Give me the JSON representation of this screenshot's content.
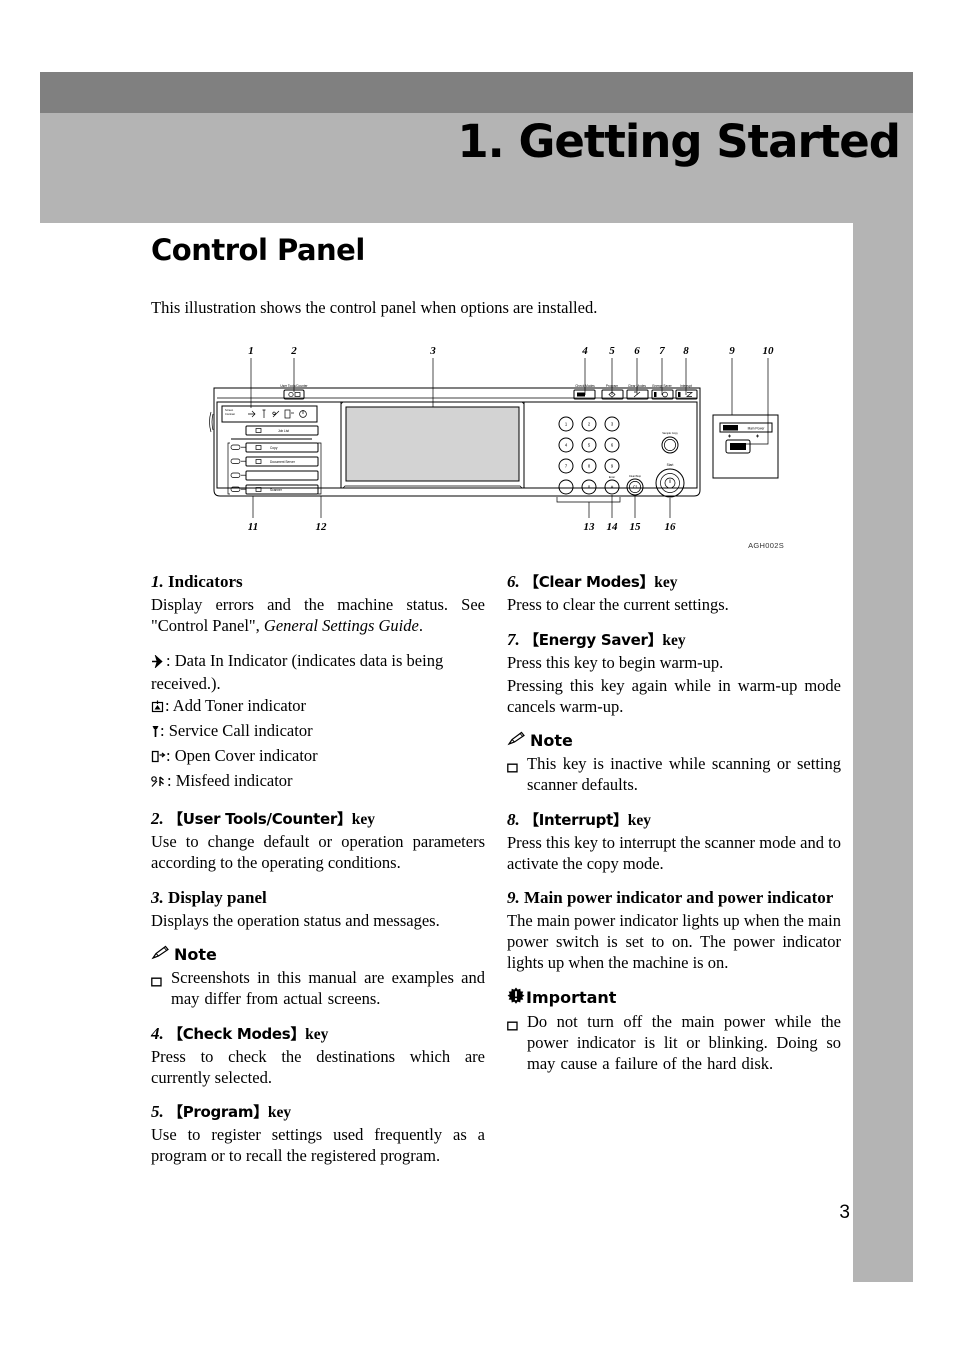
{
  "chapter": {
    "title": "1. Getting Started"
  },
  "section": {
    "title": "Control Panel",
    "intro": "This illustration shows the control panel when options are installed."
  },
  "figure": {
    "id_label": "AGH002S",
    "callout_numbers_top": [
      "1",
      "2",
      "3",
      "4",
      "5",
      "6",
      "7",
      "8",
      "9",
      "10"
    ],
    "callout_numbers_bottom": [
      "11",
      "12",
      "13",
      "14",
      "15",
      "16"
    ],
    "panel_labels": {
      "user_tools_counter": "User Tools/Counter",
      "check_modes": "Check Modes",
      "program": "Program",
      "clear_modes": "Clear Modes",
      "energy_saver": "Energy Saver",
      "interrupt": "Interrupt",
      "main_power": "Main Power",
      "on": "On",
      "sample_copy": "Sample Copy",
      "start": "Start",
      "clear_stop": "Clear/Stop",
      "job_list": "Job List",
      "copy": "Copy",
      "document_server": "Document Server",
      "scanner": "Scanner",
      "screen_contrast": "Screen Contrast"
    },
    "keypad_keys": [
      "1",
      "2",
      "3",
      "4",
      "5",
      "6",
      "7",
      "8",
      "9",
      ".",
      "0",
      "#"
    ]
  },
  "items": {
    "left": [
      {
        "num": "1.",
        "heading": "Indicators",
        "heading_kind": "plain",
        "paragraphs": [
          {
            "kind": "rich",
            "parts": [
              {
                "text": "Display errors and the machine status. See \"Control Panel\", ",
                "italic": false
              },
              {
                "text": "General Settings Guide",
                "italic": true
              },
              {
                "text": ".",
                "italic": false
              }
            ]
          }
        ],
        "indicators": [
          {
            "icon": "data-in-icon",
            "text": ": Data In Indicator (indicates data is being received.)."
          },
          {
            "icon": "add-toner-icon",
            "text": ": Add Toner indicator"
          },
          {
            "icon": "service-call-icon",
            "text": ": Service Call indicator"
          },
          {
            "icon": "open-cover-icon",
            "text": ": Open Cover indicator"
          },
          {
            "icon": "misfeed-icon",
            "text": ": Misfeed indicator"
          }
        ]
      },
      {
        "num": "2.",
        "heading_key": "User Tools/Counter",
        "heading_suffix": "key",
        "heading_kind": "key",
        "paragraphs": [
          {
            "kind": "plain",
            "text": "Use to change default or operation parameters according to the operating conditions."
          }
        ]
      },
      {
        "num": "3.",
        "heading": "Display panel",
        "heading_kind": "plain",
        "paragraphs": [
          {
            "kind": "plain",
            "text": "Displays the operation status and messages."
          }
        ],
        "note": {
          "label": "Note",
          "bullets": [
            "Screenshots in this manual are examples and may differ from actual screens."
          ]
        }
      },
      {
        "num": "4.",
        "heading_key": "Check Modes",
        "heading_suffix": "key",
        "heading_kind": "key",
        "paragraphs": [
          {
            "kind": "plain",
            "text": "Press to check the destinations which are currently selected."
          }
        ]
      },
      {
        "num": "5.",
        "heading_key": "Program",
        "heading_suffix": "key",
        "heading_kind": "key",
        "paragraphs": [
          {
            "kind": "plain",
            "text": "Use to register settings used frequently as a program or to recall the registered program."
          }
        ]
      }
    ],
    "right": [
      {
        "num": "6.",
        "heading_key": "Clear Modes",
        "heading_suffix": "key",
        "heading_kind": "key",
        "paragraphs": [
          {
            "kind": "plain",
            "text": "Press to clear the current settings."
          }
        ]
      },
      {
        "num": "7.",
        "heading_key": "Energy Saver",
        "heading_suffix": "key",
        "heading_kind": "key",
        "paragraphs": [
          {
            "kind": "plain",
            "text": "Press this key to begin warm-up."
          },
          {
            "kind": "plain",
            "text": "Pressing this key again while in warm-up mode cancels warm-up."
          }
        ],
        "note": {
          "label": "Note",
          "bullets": [
            "This key is inactive while scanning or setting scanner defaults."
          ]
        }
      },
      {
        "num": "8.",
        "heading_key": "Interrupt",
        "heading_suffix": "key",
        "heading_kind": "key",
        "paragraphs": [
          {
            "kind": "plain",
            "text": "Press this key to interrupt the scanner mode and to activate the copy mode."
          }
        ]
      },
      {
        "num": "9.",
        "heading": "Main power indicator and power indicator",
        "heading_kind": "plain",
        "paragraphs": [
          {
            "kind": "plain",
            "text": "The main power indicator lights up when the main power switch is set to on. The power indicator lights up when the machine is on."
          }
        ],
        "important": {
          "label": "Important",
          "bullets": [
            "Do not turn off the main power while the power indicator is lit or blinking. Doing so may cause a failure of the hard disk."
          ]
        }
      }
    ]
  },
  "page": {
    "number": "3"
  },
  "colors": {
    "band_dark": "#808080",
    "band_light": "#b4b4b4",
    "display_panel_fill": "#d3d3d3",
    "text": "#000000"
  }
}
